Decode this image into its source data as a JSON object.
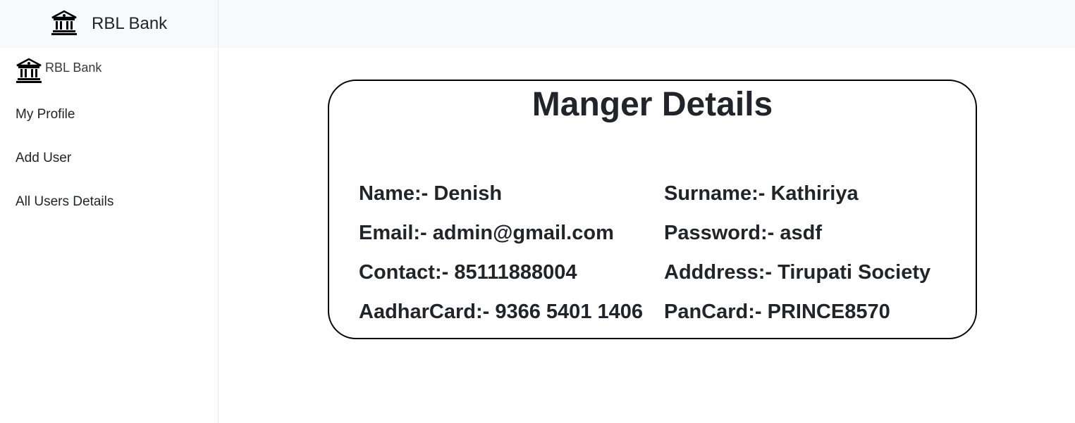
{
  "sidebar": {
    "header": {
      "icon": "bank-icon",
      "title": "RBL Bank"
    },
    "brand": {
      "icon": "bank-icon",
      "label": "RBL Bank"
    },
    "items": [
      {
        "label": "My Profile"
      },
      {
        "label": "Add User"
      },
      {
        "label": "All Users Details"
      }
    ]
  },
  "card": {
    "title": "Manger Details",
    "fields": {
      "name": "Name:- Denish",
      "surname": "Surname:- Kathiriya",
      "email": "Email:- admin@gmail.com",
      "password": "Password:- asdf",
      "contact": "Contact:- 85111888004",
      "address": "Adddress:- Tirupati Society",
      "aadhar": "AadharCard:- 9366 5401 1406",
      "pan": "PanCard:- PRINCE8570"
    }
  }
}
